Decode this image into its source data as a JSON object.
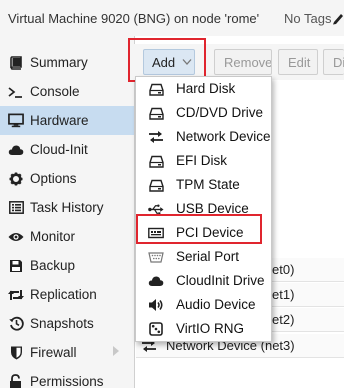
{
  "header": {
    "title": "Virtual Machine 9020 (BNG) on node 'rome'",
    "tags_label": "No Tags"
  },
  "sidebar": {
    "items": [
      {
        "label": "Summary",
        "icon": "book-icon",
        "active": false
      },
      {
        "label": "Console",
        "icon": "terminal-icon",
        "active": false
      },
      {
        "label": "Hardware",
        "icon": "desktop-icon",
        "active": true
      },
      {
        "label": "Cloud-Init",
        "icon": "cloud-icon",
        "active": false
      },
      {
        "label": "Options",
        "icon": "gear-icon",
        "active": false
      },
      {
        "label": "Task History",
        "icon": "list-icon",
        "active": false
      },
      {
        "label": "Monitor",
        "icon": "eye-icon",
        "active": false
      },
      {
        "label": "Backup",
        "icon": "floppy-icon",
        "active": false
      },
      {
        "label": "Replication",
        "icon": "retweet-icon",
        "active": false
      },
      {
        "label": "Snapshots",
        "icon": "history-icon",
        "active": false
      },
      {
        "label": "Firewall",
        "icon": "shield-icon",
        "active": false
      },
      {
        "label": "Permissions",
        "icon": "unlock-icon",
        "active": false
      }
    ]
  },
  "toolbar": {
    "add_label": "Add",
    "remove_label": "Remove",
    "edit_label": "Edit",
    "overflow_label": "Di"
  },
  "add_menu": {
    "items": [
      {
        "label": "Hard Disk",
        "icon": "hdd-icon"
      },
      {
        "label": "CD/DVD Drive",
        "icon": "cdrom-icon"
      },
      {
        "label": "Network Device",
        "icon": "network-icon"
      },
      {
        "label": "EFI Disk",
        "icon": "hdd-icon"
      },
      {
        "label": "TPM State",
        "icon": "hdd-icon"
      },
      {
        "label": "USB Device",
        "icon": "usb-icon"
      },
      {
        "label": "PCI Device",
        "icon": "pci-card-icon"
      },
      {
        "label": "Serial Port",
        "icon": "serial-port-icon"
      },
      {
        "label": "CloudInit Drive",
        "icon": "cloud-icon"
      },
      {
        "label": "Audio Device",
        "icon": "volume-icon"
      },
      {
        "label": "VirtIO RNG",
        "icon": "dice-icon"
      }
    ],
    "highlighted": "PCI Device"
  },
  "hardware_rows": [
    {
      "text": "et0)"
    },
    {
      "text": "et1)"
    },
    {
      "text": "et2)"
    },
    {
      "text": "Network Device (net3)"
    }
  ],
  "colors": {
    "highlight_box": "#e0252e",
    "active_nav": "#c7dcf0",
    "add_button": "#dbe7f3"
  }
}
